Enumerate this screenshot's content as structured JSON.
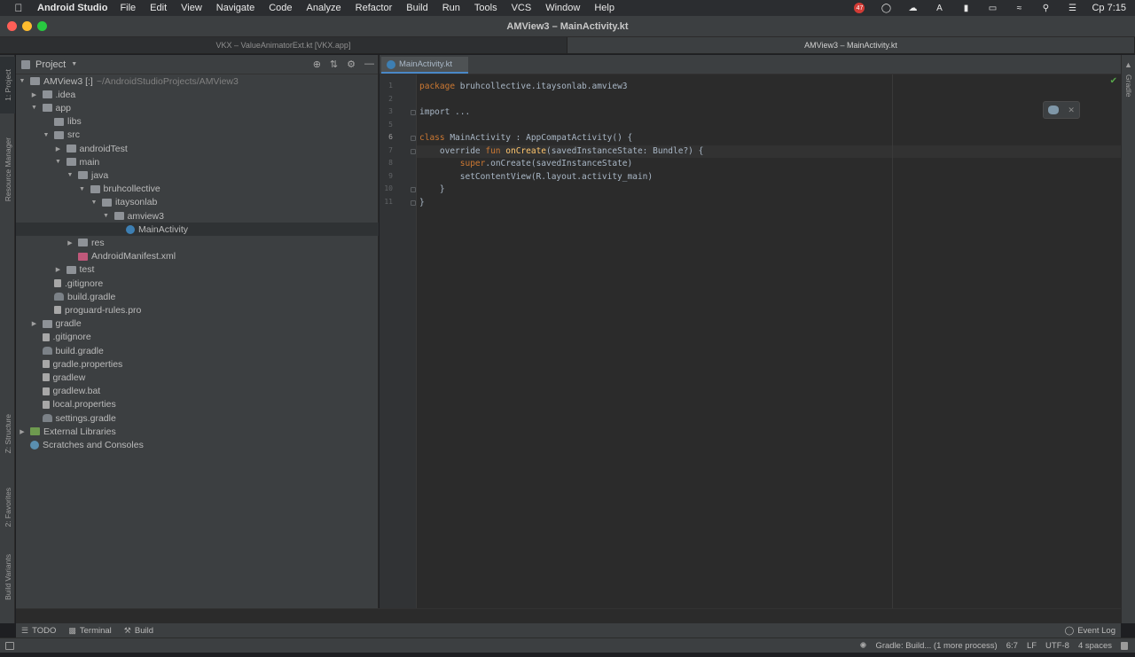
{
  "menubar": {
    "app_name": "Android Studio",
    "items": [
      "File",
      "Edit",
      "View",
      "Navigate",
      "Code",
      "Analyze",
      "Refactor",
      "Build",
      "Run",
      "Tools",
      "VCS",
      "Window",
      "Help"
    ],
    "notification_count": "47",
    "keyboard_layout": "A",
    "clock": "Cp 7:15"
  },
  "window": {
    "title": "AMView3 – MainActivity.kt",
    "tabs": [
      {
        "label": "VKX – ValueAnimatorExt.kt [VKX.app]",
        "active": false
      },
      {
        "label": "AMView3 – MainActivity.kt",
        "active": true
      }
    ]
  },
  "left_strip": {
    "project": "1: Project",
    "resource_manager": "Resource Manager",
    "structure": "Z: Structure",
    "favorites": "2: Favorites",
    "build_variants": "Build Variants"
  },
  "right_strip": {
    "gradle": "Gradle"
  },
  "project_panel": {
    "title": "Project",
    "tree": [
      {
        "label": "AMView3 [:]",
        "sub": "~/AndroidStudioProjects/AMView3",
        "depth": 0,
        "arrow": "open",
        "icon": "folder"
      },
      {
        "label": ".idea",
        "depth": 1,
        "arrow": "closed",
        "icon": "folder"
      },
      {
        "label": "app",
        "depth": 1,
        "arrow": "open",
        "icon": "folder"
      },
      {
        "label": "libs",
        "depth": 2,
        "arrow": "",
        "icon": "folder"
      },
      {
        "label": "src",
        "depth": 2,
        "arrow": "open",
        "icon": "folder"
      },
      {
        "label": "androidTest",
        "depth": 3,
        "arrow": "closed",
        "icon": "folder"
      },
      {
        "label": "main",
        "depth": 3,
        "arrow": "open",
        "icon": "folder"
      },
      {
        "label": "java",
        "depth": 4,
        "arrow": "open",
        "icon": "folder"
      },
      {
        "label": "bruhcollective",
        "depth": 5,
        "arrow": "open",
        "icon": "folder"
      },
      {
        "label": "itaysonlab",
        "depth": 6,
        "arrow": "open",
        "icon": "folder"
      },
      {
        "label": "amview3",
        "depth": 7,
        "arrow": "open",
        "icon": "folder"
      },
      {
        "label": "MainActivity",
        "depth": 8,
        "arrow": "",
        "icon": "kotlin",
        "selected": true
      },
      {
        "label": "res",
        "depth": 4,
        "arrow": "closed",
        "icon": "folder"
      },
      {
        "label": "AndroidManifest.xml",
        "depth": 4,
        "arrow": "",
        "icon": "xml"
      },
      {
        "label": "test",
        "depth": 3,
        "arrow": "closed",
        "icon": "folder"
      },
      {
        "label": ".gitignore",
        "depth": 2,
        "arrow": "",
        "icon": "file"
      },
      {
        "label": "build.gradle",
        "depth": 2,
        "arrow": "",
        "icon": "gradle"
      },
      {
        "label": "proguard-rules.pro",
        "depth": 2,
        "arrow": "",
        "icon": "file"
      },
      {
        "label": "gradle",
        "depth": 1,
        "arrow": "closed",
        "icon": "folder"
      },
      {
        "label": ".gitignore",
        "depth": 1,
        "arrow": "",
        "icon": "file"
      },
      {
        "label": "build.gradle",
        "depth": 1,
        "arrow": "",
        "icon": "gradle"
      },
      {
        "label": "gradle.properties",
        "depth": 1,
        "arrow": "",
        "icon": "file"
      },
      {
        "label": "gradlew",
        "depth": 1,
        "arrow": "",
        "icon": "file"
      },
      {
        "label": "gradlew.bat",
        "depth": 1,
        "arrow": "",
        "icon": "file"
      },
      {
        "label": "local.properties",
        "depth": 1,
        "arrow": "",
        "icon": "file"
      },
      {
        "label": "settings.gradle",
        "depth": 1,
        "arrow": "",
        "icon": "gradle"
      },
      {
        "label": "External Libraries",
        "depth": 0,
        "arrow": "closed",
        "icon": "lib"
      },
      {
        "label": "Scratches and Consoles",
        "depth": 0,
        "arrow": "",
        "icon": "scratch"
      }
    ]
  },
  "editor": {
    "tab_label": "MainActivity.kt",
    "current_line": "6",
    "lines": [
      {
        "n": "1",
        "parts": [
          {
            "t": "package",
            "c": "kw"
          },
          {
            "t": " bruhcollective.itaysonlab.amview3",
            "c": "pl"
          }
        ]
      },
      {
        "n": "2",
        "parts": []
      },
      {
        "n": "3",
        "parts": [
          {
            "t": "import",
            "c": "pl"
          },
          {
            "t": " ...",
            "c": "pl"
          }
        ]
      },
      {
        "n": "5",
        "parts": []
      },
      {
        "n": "6",
        "parts": [
          {
            "t": "class",
            "c": "kw"
          },
          {
            "t": " MainActivity : AppCompatActivity() {",
            "c": "pl"
          }
        ]
      },
      {
        "n": "7",
        "parts": [
          {
            "t": "    override ",
            "c": "pl"
          },
          {
            "t": "fun",
            "c": "kw"
          },
          {
            "t": " onCreate",
            "c": "fn"
          },
          {
            "t": "(savedInstanceState: Bundle?) {",
            "c": "pl"
          }
        ]
      },
      {
        "n": "8",
        "parts": [
          {
            "t": "        ",
            "c": "pl"
          },
          {
            "t": "super",
            "c": "kw"
          },
          {
            "t": ".onCreate(savedInstanceState)",
            "c": "pl"
          }
        ]
      },
      {
        "n": "9",
        "parts": [
          {
            "t": "        setContentView(R.layout.activity_main)",
            "c": "pl"
          }
        ]
      },
      {
        "n": "10",
        "parts": [
          {
            "t": "    }",
            "c": "pl"
          }
        ]
      },
      {
        "n": "11",
        "parts": [
          {
            "t": "}",
            "c": "pl"
          }
        ]
      }
    ]
  },
  "bottom_tools": {
    "todo": "TODO",
    "terminal": "Terminal",
    "build": "Build",
    "event_log": "Event Log"
  },
  "status": {
    "progress": "Gradle: Build... (1 more process)",
    "position": "6:7",
    "line_sep": "LF",
    "encoding": "UTF-8",
    "indent": "4 spaces"
  },
  "colors": {
    "keyword": "#cc7832",
    "function": "#ffc66d",
    "plain": "#a9b7c6",
    "accent": "#4a88c7"
  }
}
